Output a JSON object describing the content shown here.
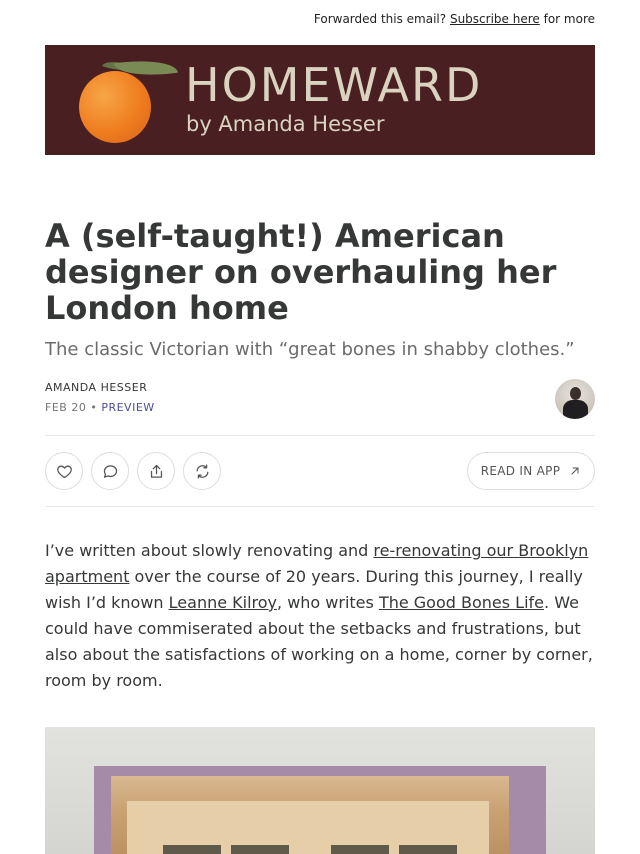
{
  "topbar": {
    "prefix": "Forwarded this email?",
    "link": "Subscribe here",
    "suffix": "for more"
  },
  "banner": {
    "brand": "HOMEWARD",
    "byline": "by Amanda Hesser",
    "color": "#4a1f22"
  },
  "post": {
    "title": "A (self-taught!) American designer on overhauling her London home",
    "subtitle": "The classic Victorian with “great bones in shabby clothes.”",
    "author": "AMANDA HESSER",
    "date": "FEB 20",
    "separator": "•",
    "access": "PREVIEW"
  },
  "actions": {
    "like_icon": "heart-icon",
    "comment_icon": "comment-icon",
    "share_icon": "share-icon",
    "restack_icon": "restack-icon",
    "read_in_app": "READ IN APP",
    "read_in_app_icon": "arrow-up-right-icon"
  },
  "body": {
    "p1_a": "I’ve written about slowly renovating and ",
    "p1_link1": "re-renovating our Brooklyn apartment",
    "p1_b": " over the course of 20 years. During this journey, I really wish I’d known ",
    "p1_link2": "Leanne Kilroy",
    "p1_c": ", who writes ",
    "p1_link3": "The Good Bones Life",
    "p1_d": ". We could have commiserated about the setbacks and frustrations, but also about the satisfactions of working on a home, corner by corner, room by room."
  }
}
